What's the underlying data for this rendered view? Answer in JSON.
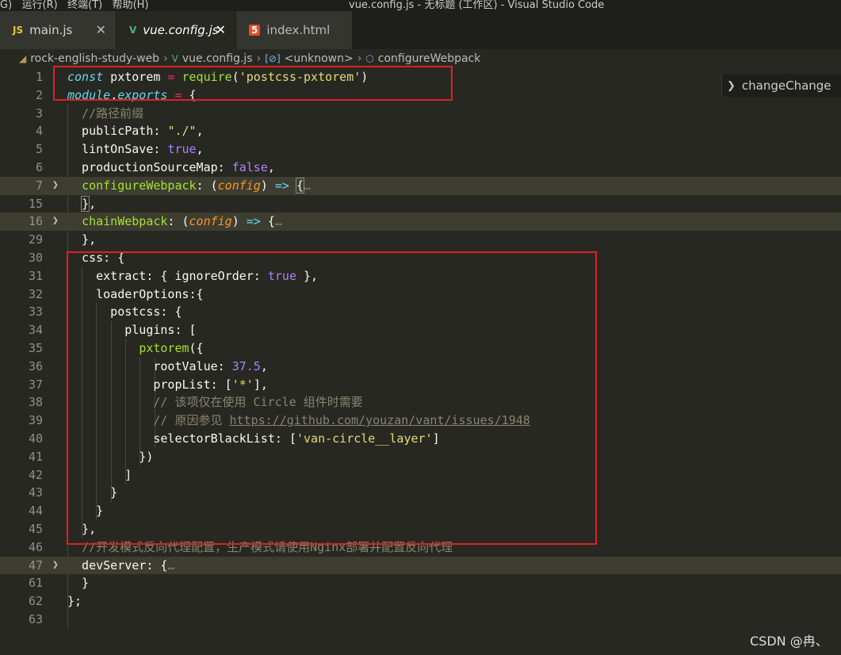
{
  "window": {
    "menu_text": "G)   运行(R)   终端(T)   帮助(H)",
    "title": "vue.config.js - 无标题 (工作区) - Visual Studio Code"
  },
  "tabs": [
    {
      "label": "main.js",
      "icon": "JS",
      "icon_name": "js-file-icon"
    },
    {
      "label": "vue.config.js",
      "icon": "V",
      "icon_name": "vue-file-icon"
    },
    {
      "label": "index.html",
      "icon": "5",
      "icon_name": "html5-file-icon"
    }
  ],
  "breadcrumb": {
    "folder": "rock-english-study-web",
    "file": "vue.config.js",
    "symbol1": "<unknown>",
    "symbol2": "configureWebpack"
  },
  "peek": {
    "label": "changeChange"
  },
  "editor": {
    "lines": [
      {
        "num": "1",
        "code": "const pxtorem = require('postcss-pxtorem')"
      },
      {
        "num": "2",
        "code": "module.exports = {"
      },
      {
        "num": "3",
        "code": "  //路径前缀"
      },
      {
        "num": "4",
        "code": "  publicPath: \"./\","
      },
      {
        "num": "5",
        "code": "  lintOnSave: true,"
      },
      {
        "num": "6",
        "code": "  productionSourceMap: false,"
      },
      {
        "num": "7",
        "code": "  configureWebpack: (config) => {…"
      },
      {
        "num": "15",
        "code": "  },"
      },
      {
        "num": "16",
        "code": "  chainWebpack: (config) => {…"
      },
      {
        "num": "29",
        "code": "  },"
      },
      {
        "num": "30",
        "code": "  css: {"
      },
      {
        "num": "31",
        "code": "    extract: { ignoreOrder: true },"
      },
      {
        "num": "32",
        "code": "    loaderOptions:{"
      },
      {
        "num": "33",
        "code": "      postcss: {"
      },
      {
        "num": "34",
        "code": "        plugins: ["
      },
      {
        "num": "35",
        "code": "          pxtorem({"
      },
      {
        "num": "36",
        "code": "            rootValue: 37.5,"
      },
      {
        "num": "37",
        "code": "            propList: ['*'],"
      },
      {
        "num": "38",
        "code": "            // 该项仅在使用 Circle 组件时需要"
      },
      {
        "num": "39",
        "code": "            // 原因参见 https://github.com/youzan/vant/issues/1948"
      },
      {
        "num": "40",
        "code": "            selectorBlackList: ['van-circle__layer']"
      },
      {
        "num": "41",
        "code": "          })"
      },
      {
        "num": "42",
        "code": "        ]"
      },
      {
        "num": "43",
        "code": "      }"
      },
      {
        "num": "44",
        "code": "    }"
      },
      {
        "num": "45",
        "code": "  },"
      },
      {
        "num": "46",
        "code": "  //开发模式反向代理配置，生产模式请使用Nginx部署并配置反向代理"
      },
      {
        "num": "47",
        "code": "  devServer: {…"
      },
      {
        "num": "61",
        "code": "  }"
      },
      {
        "num": "62",
        "code": "};"
      },
      {
        "num": "63",
        "code": ""
      }
    ]
  },
  "watermark": "CSDN @冉、",
  "colors": {
    "background": "#272822",
    "keyword": "#66d9ef",
    "string": "#e6db74",
    "function": "#a6e22e",
    "operator": "#f92672",
    "comment": "#88846f",
    "number": "#ae81ff",
    "annotation_box": "#e02020"
  }
}
